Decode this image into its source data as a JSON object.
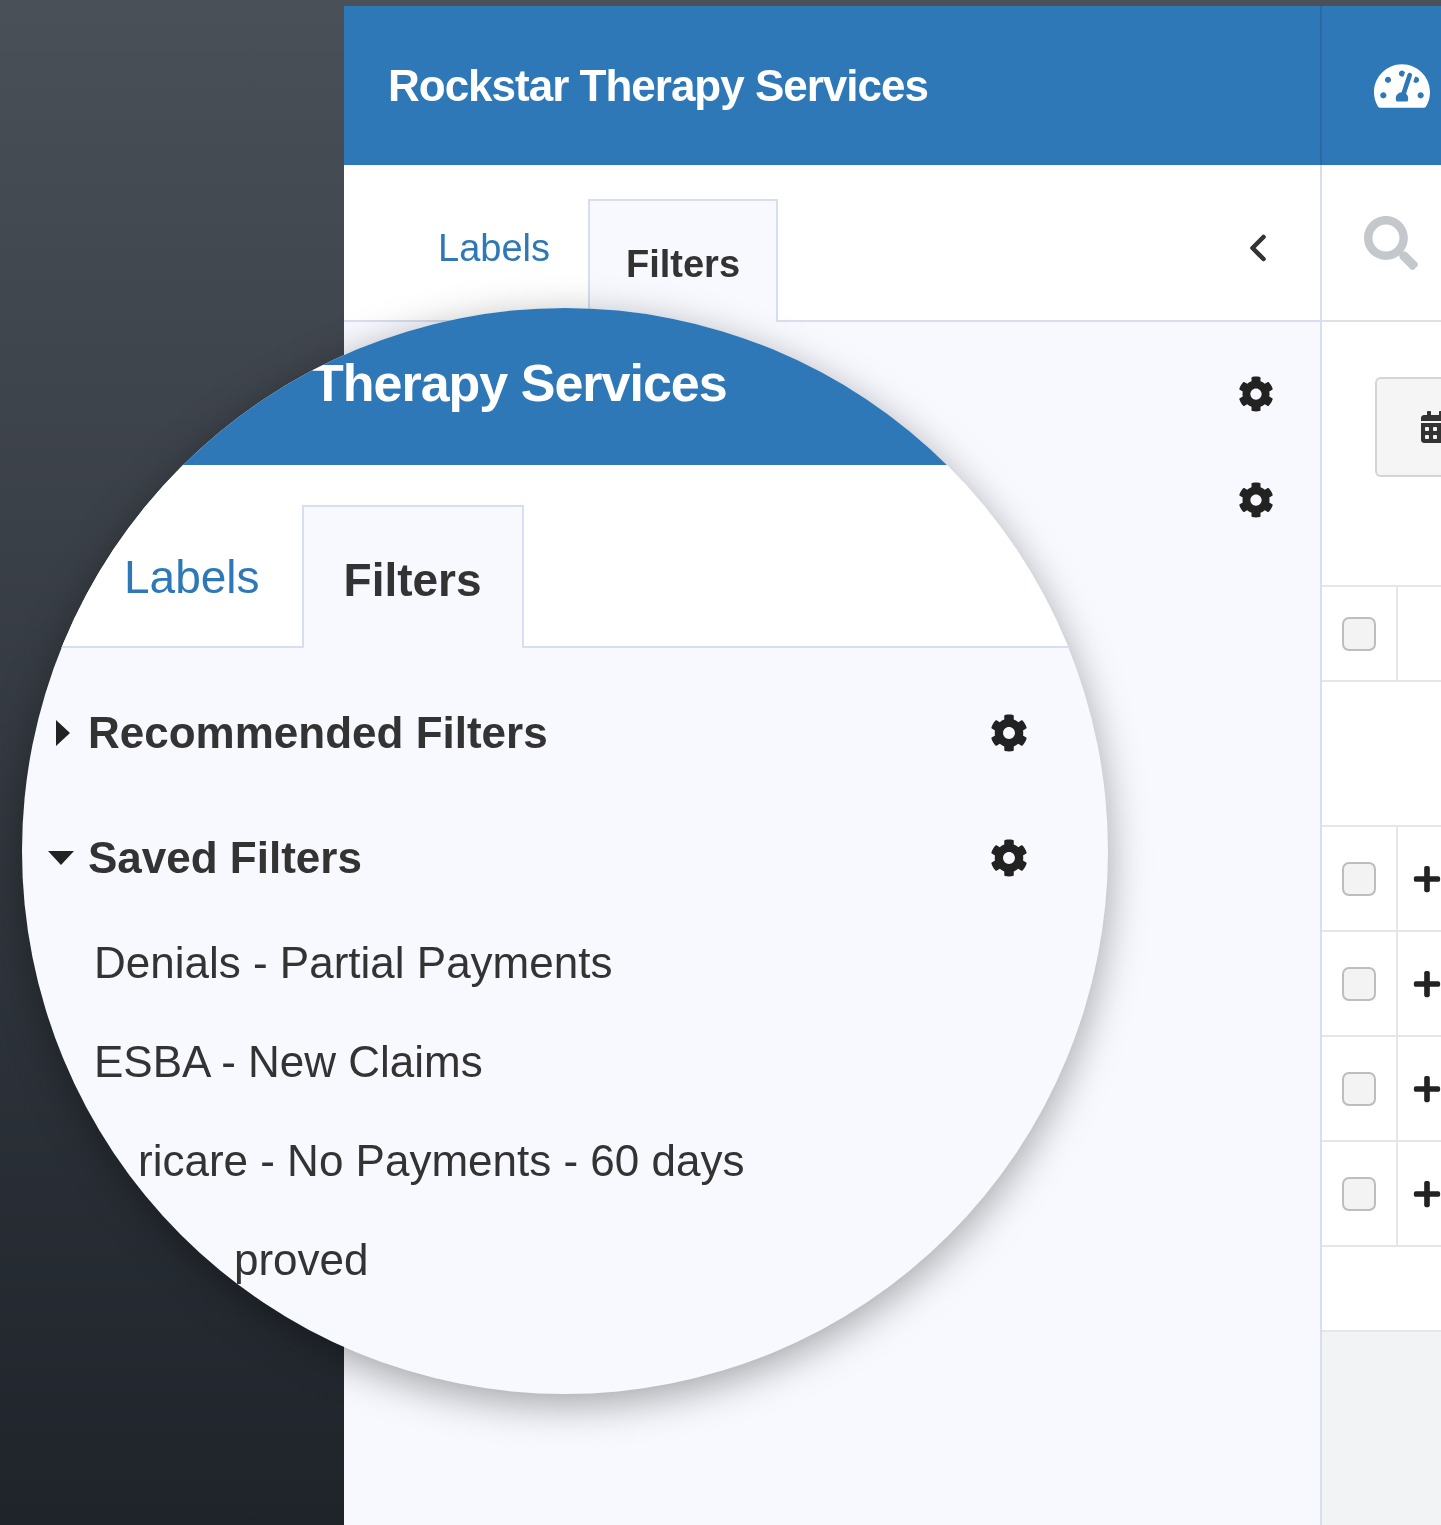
{
  "app": {
    "title": "Rockstar Therapy Services"
  },
  "sidebar": {
    "tabs": [
      {
        "label": "Labels",
        "selected": false
      },
      {
        "label": "Filters",
        "selected": true
      }
    ]
  },
  "table": {
    "header_checkbox": {
      "checked": false
    },
    "rows": [
      {
        "checked": false
      },
      {
        "checked": false
      },
      {
        "checked": false
      },
      {
        "checked": false
      }
    ]
  },
  "magnifier": {
    "title": "Therapy Services",
    "tabs": [
      {
        "label": "Labels",
        "selected": false
      },
      {
        "label": "Filters",
        "selected": true
      }
    ],
    "sections": [
      {
        "label": "Recommended Filters",
        "expanded": false
      },
      {
        "label": "Saved Filters",
        "expanded": true,
        "items": [
          "Denials - Partial Payments",
          "ESBA - New Claims",
          "ricare - No Payments - 60 days",
          "proved"
        ]
      }
    ]
  }
}
